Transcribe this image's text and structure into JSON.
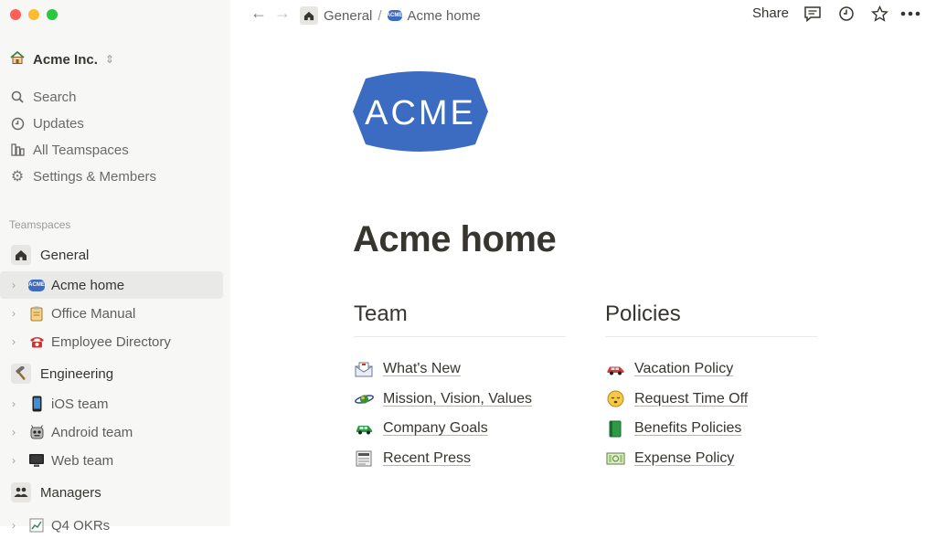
{
  "window": {
    "traffic_lights": [
      "#ff5f57",
      "#febc2e",
      "#28c840"
    ]
  },
  "sidebar": {
    "workspace": {
      "name": "Acme Inc.",
      "icon": "house-icon",
      "switch_icon": "chevron-updown-icon"
    },
    "nav": [
      {
        "label": "Search",
        "icon": "search-icon"
      },
      {
        "label": "Updates",
        "icon": "clock-icon"
      },
      {
        "label": "All Teamspaces",
        "icon": "teamspaces-icon"
      },
      {
        "label": "Settings & Members",
        "icon": "gear-icon"
      }
    ],
    "section_label": "Teamspaces",
    "teamspaces": [
      {
        "label": "General",
        "icon": "home-icon"
      },
      {
        "label": "Engineering",
        "icon": "hammer-icon"
      },
      {
        "label": "Managers",
        "icon": "people-icon"
      }
    ],
    "pages": [
      {
        "label": "Acme home",
        "icon": "acme-logo-icon",
        "active": true
      },
      {
        "label": "Office Manual",
        "icon": "clipboard-icon"
      },
      {
        "label": "Employee Directory",
        "icon": "telephone-icon"
      },
      {
        "label": "iOS team",
        "icon": "phone-icon"
      },
      {
        "label": "Android team",
        "icon": "robot-icon"
      },
      {
        "label": "Web team",
        "icon": "computer-icon"
      },
      {
        "label": "Q4 OKRs",
        "icon": "chart-icon"
      }
    ]
  },
  "topbar": {
    "breadcrumb": {
      "parent": "General",
      "separator": "/",
      "current": "Acme home"
    },
    "share_label": "Share"
  },
  "main": {
    "logo_text": "ACME",
    "logo_color": "#3b6cc1",
    "title": "Acme home",
    "team": {
      "heading": "Team",
      "links": [
        {
          "label": "What's New",
          "icon": "envelope-icon"
        },
        {
          "label": "Mission, Vision, Values",
          "icon": "planet-icon"
        },
        {
          "label": "Company Goals",
          "icon": "car-icon"
        },
        {
          "label": "Recent Press",
          "icon": "newspaper-icon"
        }
      ]
    },
    "policies": {
      "heading": "Policies",
      "links": [
        {
          "label": "Vacation Policy",
          "icon": "red-car-icon"
        },
        {
          "label": "Request Time Off",
          "icon": "sleepy-face-icon"
        },
        {
          "label": "Benefits Policies",
          "icon": "green-book-icon"
        },
        {
          "label": "Expense Policy",
          "icon": "dollar-bill-icon"
        }
      ]
    }
  }
}
